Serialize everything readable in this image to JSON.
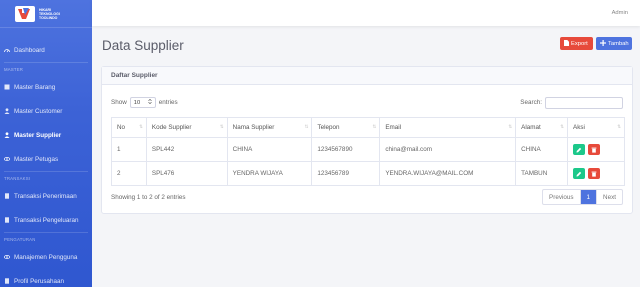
{
  "brand": {
    "line1": "HIKARI",
    "line2": "TEKNOLOGI",
    "line3": "TOOLINDO"
  },
  "topbar": {
    "user": "Admin"
  },
  "sidebar": {
    "dashboard": "Dashboard",
    "section_master": "MASTER",
    "master_barang": "Master Barang",
    "master_customer": "Master Customer",
    "master_supplier": "Master Supplier",
    "master_petugas": "Master Petugas",
    "section_transaksi": "TRANSAKSI",
    "transaksi_penerimaan": "Transaksi Penerimaan",
    "transaksi_pengeluaran": "Transaksi Pengeluaran",
    "section_pengaturan": "PENGATURAN",
    "manajemen_pengguna": "Manajemen Pengguna",
    "profil_perusahaan": "Profil Perusahaan"
  },
  "page": {
    "title": "Data Supplier",
    "export_label": "Export",
    "tambah_label": "Tambah"
  },
  "card": {
    "title": "Daftar Supplier"
  },
  "controls": {
    "show_label": "Show",
    "entries_value": "10",
    "entries_label": "entries",
    "search_label": "Search:"
  },
  "table": {
    "headers": [
      "No",
      "Kode Supplier",
      "Nama Supplier",
      "Telepon",
      "Email",
      "Alamat",
      "Aksi"
    ],
    "rows": [
      [
        "1",
        "SPL442",
        "CHINA",
        "1234567890",
        "china@mail.com",
        "CHINA"
      ],
      [
        "2",
        "SPL476",
        "YENDRA WIJAYA",
        "123456789",
        "YENDRA.WIJAYA@MAIL.COM",
        "TAMBUN"
      ]
    ]
  },
  "footer": {
    "info": "Showing 1 to 2 of 2 entries",
    "prev": "Previous",
    "page": "1",
    "next": "Next"
  },
  "colors": {
    "primary": "#4e73df",
    "danger": "#e74a3b",
    "success": "#1cc88a"
  }
}
